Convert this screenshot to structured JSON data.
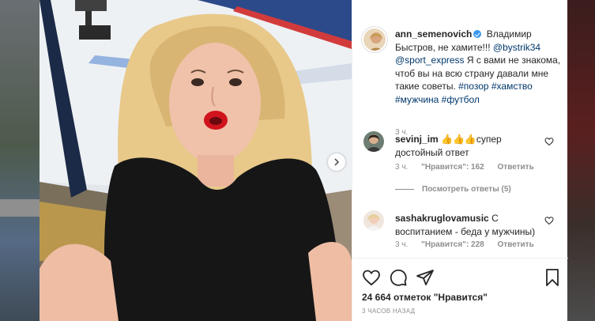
{
  "post": {
    "author": "ann_semenovich",
    "caption_text": "Владимир Быстров, не хамите!!! ",
    "mention1": "@bystrik34",
    "mention2": "@sport_express",
    "caption_rest": " Я с вами не знакома, чтоб вы на всю страну давали мне такие советы. ",
    "hashtags": "#позор #хамство #мужчина #футбол",
    "time": "3 ч."
  },
  "comments": [
    {
      "user": "sevinj_im",
      "text": "👍👍👍супер достойный ответ",
      "time": "3 ч.",
      "likes": "\"Нравится\": 162",
      "reply": "Ответить"
    },
    {
      "user": "sashakruglovamusic",
      "text": "С воспитанием - беда у мужчины)",
      "time": "3 ч.",
      "likes": "\"Нравится\": 228",
      "reply": "Ответить"
    }
  ],
  "view_replies": "Посмотреть ответы (5)",
  "footer": {
    "likes": "24 664 отметок \"Нравится\"",
    "posted": "3 ЧАСОВ НАЗАД"
  },
  "icons": {
    "like": "heart-icon",
    "comment": "comment-icon",
    "share": "share-icon",
    "save": "bookmark-icon",
    "verified": "verified-badge-icon",
    "next": "chevron-right-icon"
  },
  "colors": {
    "link": "#00376b",
    "verified": "#3897f0",
    "muted": "#8e8e8e",
    "text": "#262626"
  }
}
